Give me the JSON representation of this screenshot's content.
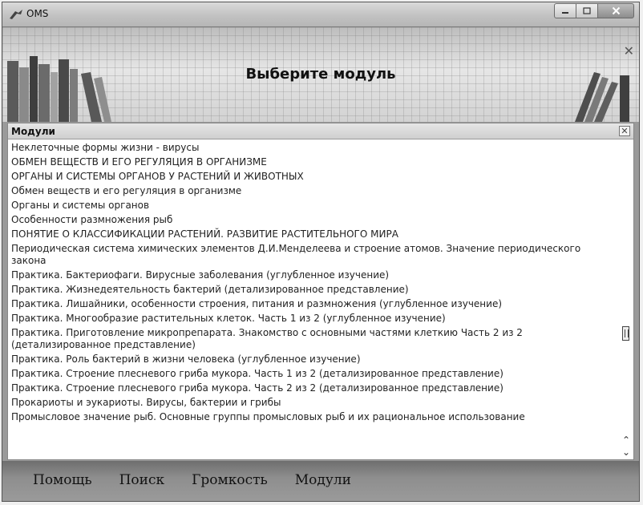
{
  "window": {
    "title": "OMS"
  },
  "banner": {
    "title": "Выберите модуль"
  },
  "panel": {
    "title": "Модули",
    "items": [
      "Неклеточные формы жизни - вирусы",
      "ОБМЕН ВЕЩЕСТВ И ЕГО РЕГУЛЯЦИЯ В ОРГАНИЗМЕ",
      "ОРГАНЫ И СИСТЕМЫ ОРГАНОВ У РАСТЕНИЙ И ЖИВОТНЫХ",
      "Обмен веществ и его регуляция в организме",
      "Органы и системы органов",
      "Особенности размножения рыб",
      "ПОНЯТИЕ О КЛАССИФИКАЦИИ РАСТЕНИЙ. РАЗВИТИЕ РАСТИТЕЛЬНОГО МИРА",
      "Периодическая система химических элементов Д.И.Менделеева и строение атомов. Значение периодического закона",
      "Практика. Бактериофаги. Вирусные заболевания (углубленное изучение)",
      "Практика. Жизнедеятельность бактерий (детализированное представление)",
      "Практика. Лишайники, особенности строения, питания и размножения (углубленное изучение)",
      "Практика. Многообразие растительных клеток. Часть 1 из 2 (углубленное изучение)",
      "Практика. Приготовление микропрепарата. Знакомство с основными частями клеткию Часть 2 из 2 (детализированное представление)",
      "Практика. Роль бактерий в жизни человека (углубленное изучение)",
      "Практика. Строение плесневого гриба мукора. Часть 1 из 2 (детализированное представление)",
      "Практика. Строение плесневого гриба мукора. Часть 2 из 2 (детализированное представление)",
      "Прокариоты и эукариоты. Вирусы, бактерии и грибы",
      "Промысловое значение рыб. Основные группы промысловых рыб и их рациональное использование"
    ]
  },
  "menu": {
    "items": [
      "Помощь",
      "Поиск",
      "Громкость",
      "Модули"
    ]
  }
}
